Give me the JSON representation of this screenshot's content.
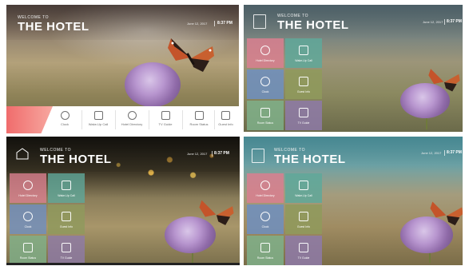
{
  "header": {
    "welcome": "WELCOME TO",
    "title": "THE HOTEL",
    "date": "June 12, 2017",
    "time": "8:37 PM"
  },
  "menu_items": [
    {
      "label": "Clock",
      "icon": "clock-icon"
    },
    {
      "label": "Wake-Up Call",
      "icon": "alarm-icon"
    },
    {
      "label": "Hotel Directory",
      "icon": "directory-icon"
    },
    {
      "label": "TV Guide",
      "icon": "tv-icon"
    },
    {
      "label": "Room Status",
      "icon": "room-status-icon"
    },
    {
      "label": "Guest Info",
      "icon": "info-icon"
    }
  ],
  "tiles": [
    {
      "label": "Hotel Directory",
      "icon": "directory-icon"
    },
    {
      "label": "Wake-Up Call",
      "icon": "alarm-icon"
    },
    {
      "label": "Clock",
      "icon": "clock-icon"
    },
    {
      "label": "Guest Info",
      "icon": "info-icon"
    },
    {
      "label": "Room Status",
      "icon": "room-status-icon"
    },
    {
      "label": "TV Guide",
      "icon": "tv-icon"
    }
  ],
  "colors": {
    "menu_accent": "#f06c6c",
    "tile_pink": "#d97f8f",
    "tile_teal": "#5fa89a",
    "tile_blue": "#6f8fc0",
    "tile_olive": "#8f9a5c",
    "tile_green": "#7fb08a",
    "tile_purple": "#8e7aa8"
  }
}
